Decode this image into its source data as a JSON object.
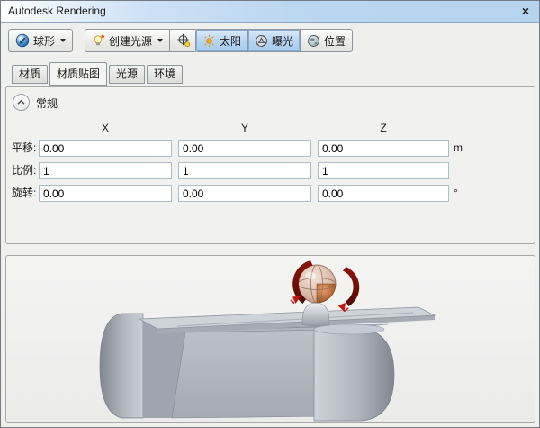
{
  "window": {
    "title": "Autodesk Rendering",
    "close_glyph": "×"
  },
  "toolbar": {
    "mapping_type_button": {
      "label": "球形"
    },
    "create_light_button": {
      "label": "创建光源"
    },
    "toggle_group": [
      {
        "label": "太阳",
        "active": true
      },
      {
        "label": "曝光",
        "active": true
      },
      {
        "label": "位置",
        "active": false
      }
    ]
  },
  "tabs": [
    {
      "label": "材质",
      "selected": false
    },
    {
      "label": "材质贴图",
      "selected": true
    },
    {
      "label": "光源",
      "selected": false
    },
    {
      "label": "环境",
      "selected": false
    }
  ],
  "general": {
    "title": "常规",
    "columns": [
      "X",
      "Y",
      "Z"
    ],
    "rows": [
      {
        "label": "平移:",
        "values": [
          "0.00",
          "0.00",
          "0.00"
        ],
        "unit": "m"
      },
      {
        "label": "比例:",
        "values": [
          "1",
          "1",
          "1"
        ],
        "unit": ""
      },
      {
        "label": "旋转:",
        "values": [
          "0.00",
          "0.00",
          "0.00"
        ],
        "unit": "°"
      }
    ]
  },
  "icons": {
    "mapping_type": "sphere-icon",
    "create_light": "lightbulb-icon",
    "target": "crosshair-target-icon",
    "sun": "sun-icon",
    "exposure": "aperture-icon",
    "location": "globe-icon",
    "collapse": "chevron-up-icon",
    "close": "x-icon"
  },
  "colors": {
    "titlebar_blue": "#bcd7f0",
    "toggle_active_blue": "#b7d5f1",
    "panel_border": "#a9a9a9",
    "input_border": "#aebdcc",
    "desk_gray": "#b4b8c0",
    "gizmo_copper": "#b06030",
    "arrow_red": "#6e1008"
  }
}
